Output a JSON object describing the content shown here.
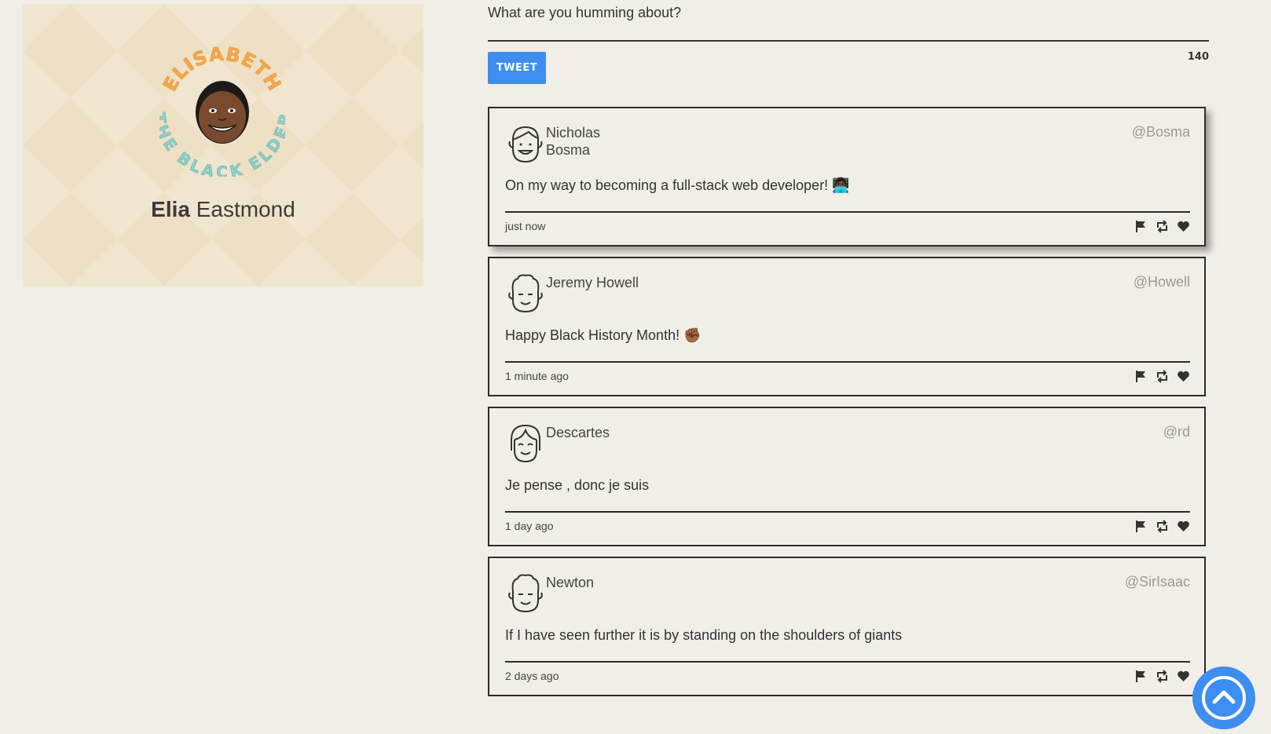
{
  "profile": {
    "badge_top_text": "ELISABETH",
    "badge_bottom_text": "THE BLACK ELDER",
    "first_name": "Elia",
    "last_name": "Eastmond"
  },
  "compose": {
    "placeholder": "What are you humming about?",
    "button_label": "Tweet",
    "counter": "140"
  },
  "tweets": [
    {
      "name": "Nicholas Bosma",
      "handle": "@Bosma",
      "content": "On my way to becoming a full-stack web developer! 👩🏿‍💻",
      "time": "just now",
      "avatar": "man-avatar-icon"
    },
    {
      "name": "Jeremy Howell",
      "handle": "@Howell",
      "content": "Happy Black History Month! ✊🏾",
      "time": "1 minute ago",
      "avatar": "curly-hair-avatar-icon"
    },
    {
      "name": "Descartes",
      "handle": "@rd",
      "content": "Je pense , donc je suis",
      "time": "1 day ago",
      "avatar": "woman-avatar-icon"
    },
    {
      "name": "Newton",
      "handle": "@SirIsaac",
      "content": "If I have seen further it is by standing on the shoulders of giants",
      "time": "2 days ago",
      "avatar": "curly-hair-avatar-icon"
    }
  ],
  "colors": {
    "accent": "#3d8ef0",
    "background": "#f1eee8",
    "card": "#ede0c4"
  }
}
